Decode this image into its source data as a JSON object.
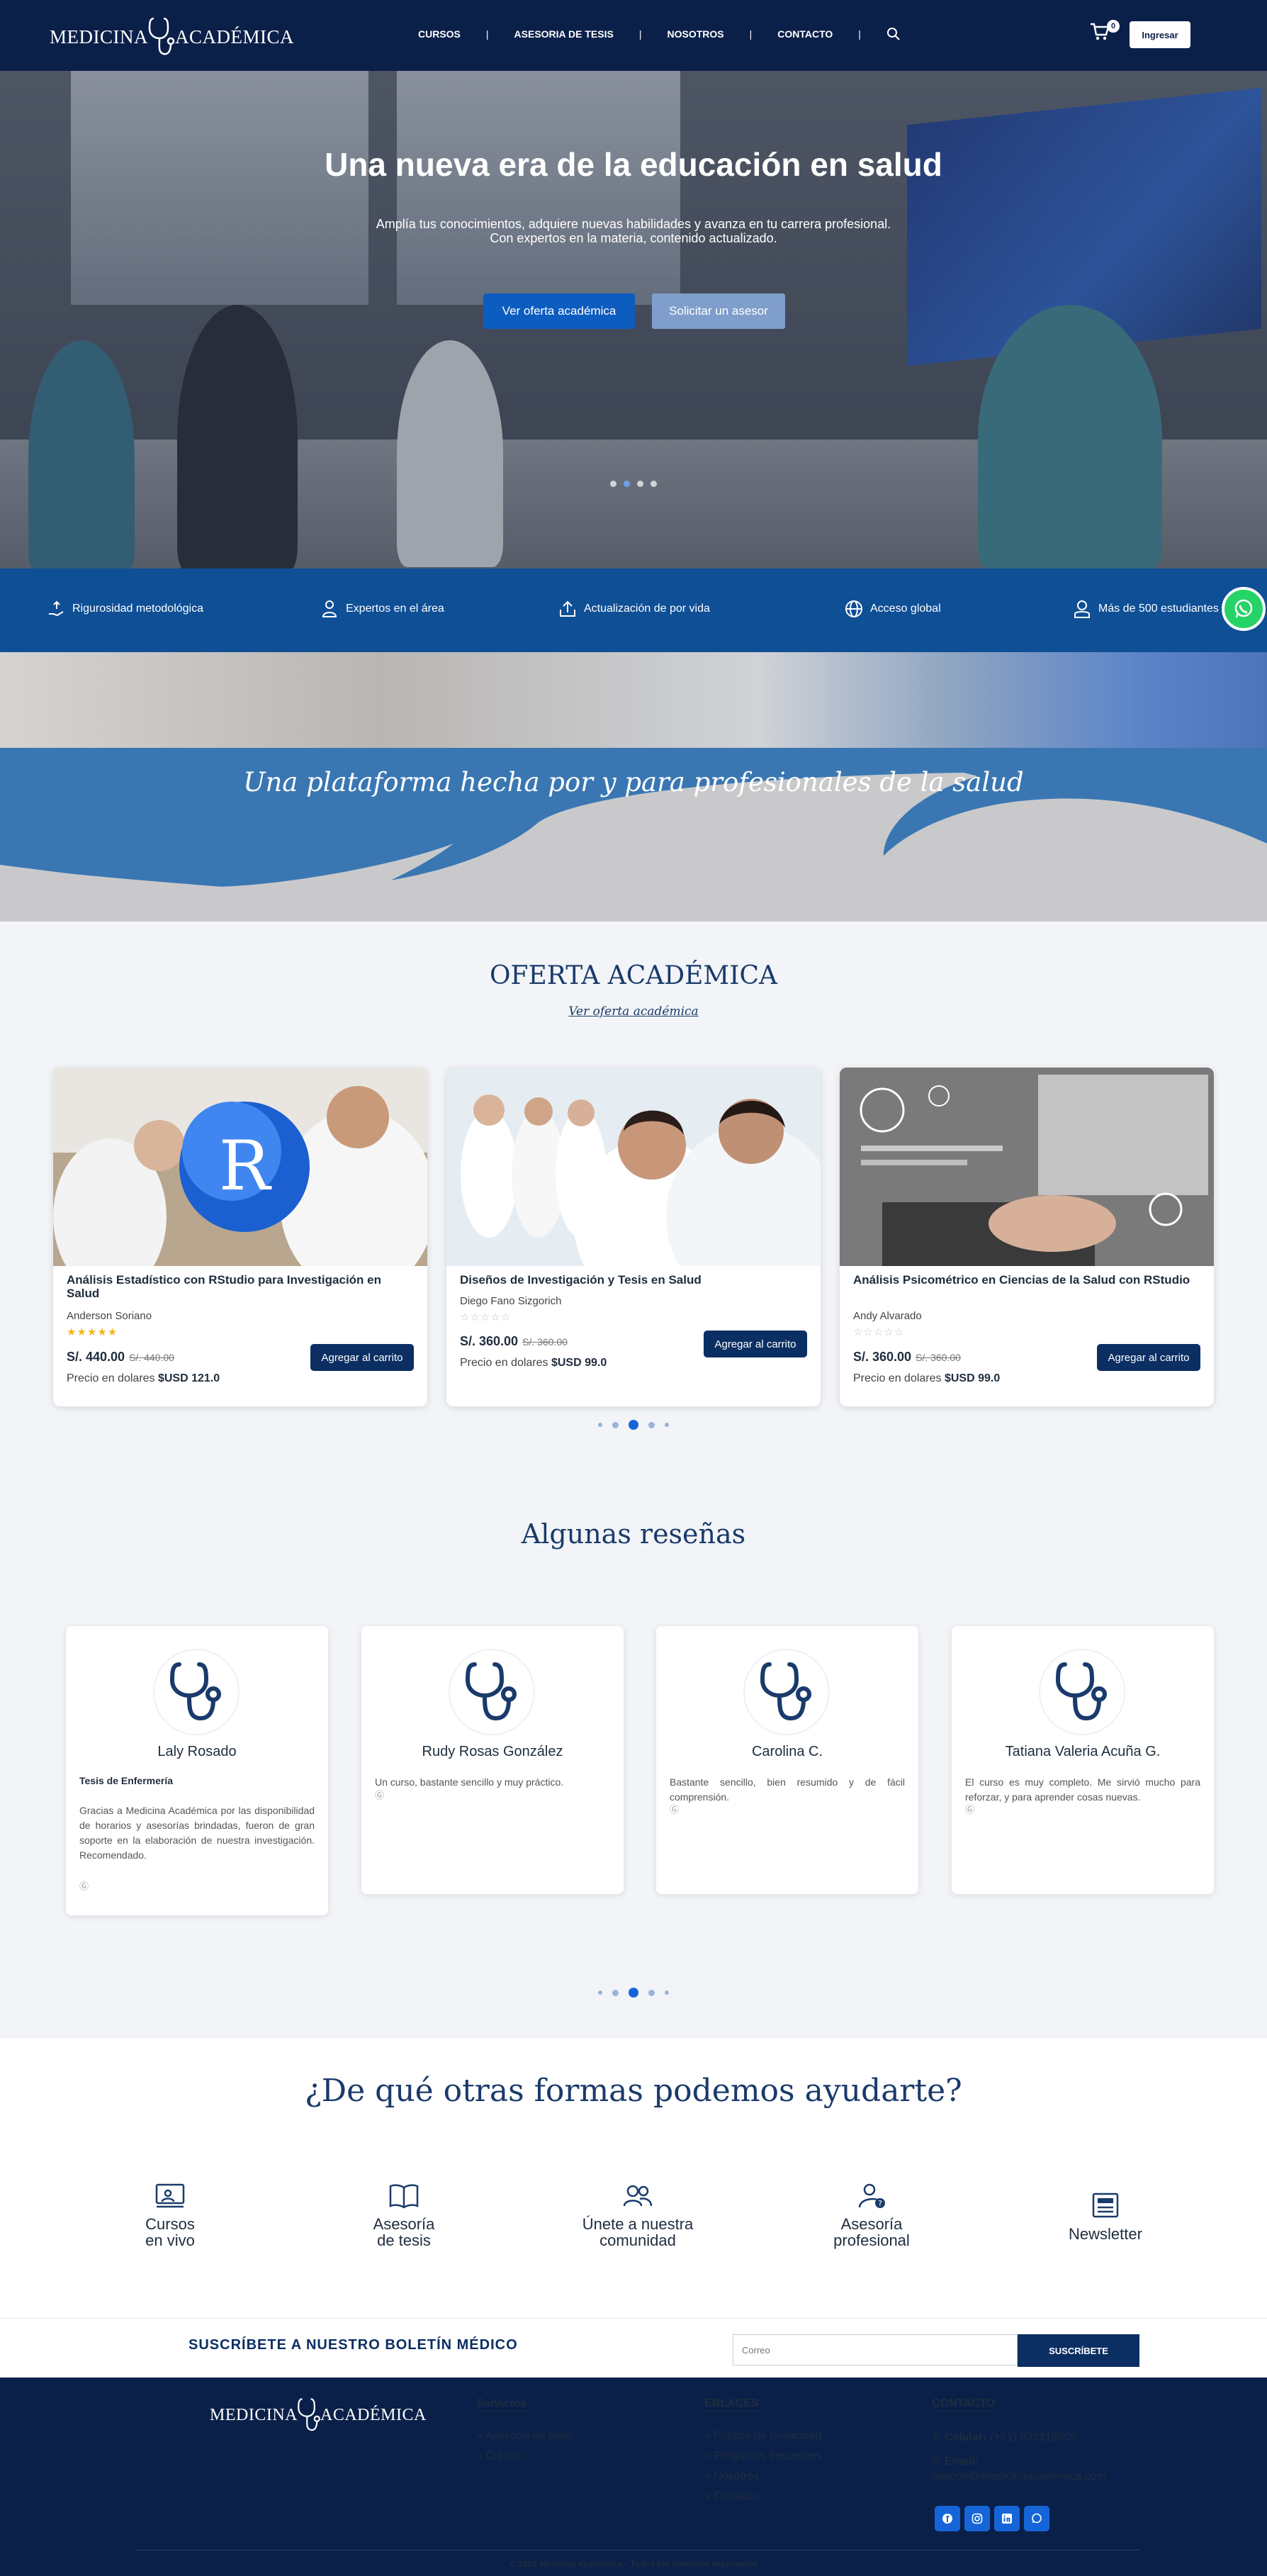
{
  "brand": {
    "left": "MEDICINA",
    "right": "ACADÉMICA"
  },
  "nav": {
    "items": [
      "CURSOS",
      "ASESORIA DE TESIS",
      "NOSOTROS",
      "CONTACTO"
    ],
    "separator": "|",
    "cart_count": "0",
    "login": "Ingresar"
  },
  "hero": {
    "title": "Una nueva era de la educación en salud",
    "subtitle_line1": "Amplía tus conocimientos, adquiere nuevas habilidades y avanza en tu carrera profesional.",
    "subtitle_line2": "Con expertos en la materia, contenido actualizado.",
    "btn_primary": "Ver oferta académica",
    "btn_secondary": "Solicitar un asesor"
  },
  "features": [
    {
      "icon": "hand-upload-icon",
      "label": "Rigurosidad metodológica"
    },
    {
      "icon": "expert-icon",
      "label": "Expertos en el área"
    },
    {
      "icon": "upload-icon",
      "label": "Actualización de por vida"
    },
    {
      "icon": "globe-icon",
      "label": "Acceso global"
    },
    {
      "icon": "student-icon",
      "label": "Más de 500 estudiantes"
    }
  ],
  "platform": {
    "title": "Una plataforma hecha por y para profesionales de la salud"
  },
  "oferta": {
    "title": "OFERTA ACADÉMICA",
    "link": "Ver oferta académica",
    "usd_prefix": "Precio en dolares",
    "add_to_cart": "Agregar al carrito",
    "courses": [
      {
        "title": "Análisis Estadístico con RStudio para Investigación en Salud",
        "author": "Anderson Soriano",
        "rating": 5,
        "price": "S/. 440.00",
        "old_price": "S/. 440.00",
        "usd": "$USD 121.0"
      },
      {
        "title": "Diseños de Investigación y Tesis en Salud",
        "author": "Diego Fano Sizgorich",
        "rating": 0,
        "price": "S/. 360.00",
        "old_price": "S/. 360.00",
        "usd": "$USD 99.0"
      },
      {
        "title": "Análisis Psicométrico en Ciencias de la Salud con RStudio",
        "author": "Andy Alvarado",
        "rating": 0,
        "price": "S/. 360.00",
        "old_price": "S/. 360.00",
        "usd": "$USD 99.0"
      }
    ]
  },
  "reviews": {
    "title": "Algunas reseñas",
    "items": [
      {
        "name": "Laly Rosado",
        "subtitle": "Tesis de Enfermería",
        "text": "Gracias a Medicina Académica por las disponibilidad de horarios y asesorías brindadas, fueron de gran soporte en la elaboración de nuestra investigación. Recomendado.",
        "source": "Ⓖ"
      },
      {
        "name": "Rudy Rosas González",
        "subtitle": "",
        "text": "Un curso, bastante sencillo y muy práctico.",
        "source": "Ⓖ"
      },
      {
        "name": "Carolina C.",
        "subtitle": "",
        "text": "Bastante sencillo, bien resumido y de fácil comprensión.",
        "source": "Ⓖ"
      },
      {
        "name": "Tatiana Valeria Acuña G.",
        "subtitle": "",
        "text": "El curso es muy completo. Me sirvió mucho para reforzar, y para aprender cosas nuevas.",
        "source": "Ⓖ"
      }
    ]
  },
  "help": {
    "title": "¿De qué otras formas podemos ayudarte?",
    "items": [
      {
        "icon": "live-course-icon",
        "line1": "Cursos",
        "line2": "en vivo"
      },
      {
        "icon": "book-icon",
        "line1": "Asesoría",
        "line2": "de tesis"
      },
      {
        "icon": "community-icon",
        "line1": "Únete a nuestra",
        "line2": "comunidad"
      },
      {
        "icon": "advisor-icon",
        "line1": "Asesoría",
        "line2": "profesional"
      },
      {
        "icon": "newsletter-icon",
        "line1": "Newsletter",
        "line2": ""
      }
    ]
  },
  "newsletter": {
    "title": "SUSCRÍBETE A NUESTRO BOLETÍN MÉDICO",
    "placeholder": "Correo",
    "button": "SUSCRÍBETE"
  },
  "footer": {
    "servicios_title": "Servicios",
    "servicios": [
      "» Asesoría de tesis",
      "» Cursos"
    ],
    "enlaces_title": "ENLACES",
    "enlaces": [
      "» Política de privacidad",
      "» Preguntas frecuentes",
      "» Nosotros",
      "» Contacto"
    ],
    "contacto_title": "CONTACTO",
    "phone_label": "Celular:",
    "phone": "(+51) 903318009",
    "email_label": "Email:",
    "email": "soporte@medicinaacademica.com",
    "copyright": "© 2023 Medicina Académica - Todos los derechos reservados"
  },
  "colors": {
    "navy": "#0b2049",
    "blue": "#0f4f96",
    "accent": "#1565d8",
    "whatsapp": "#25d366"
  }
}
